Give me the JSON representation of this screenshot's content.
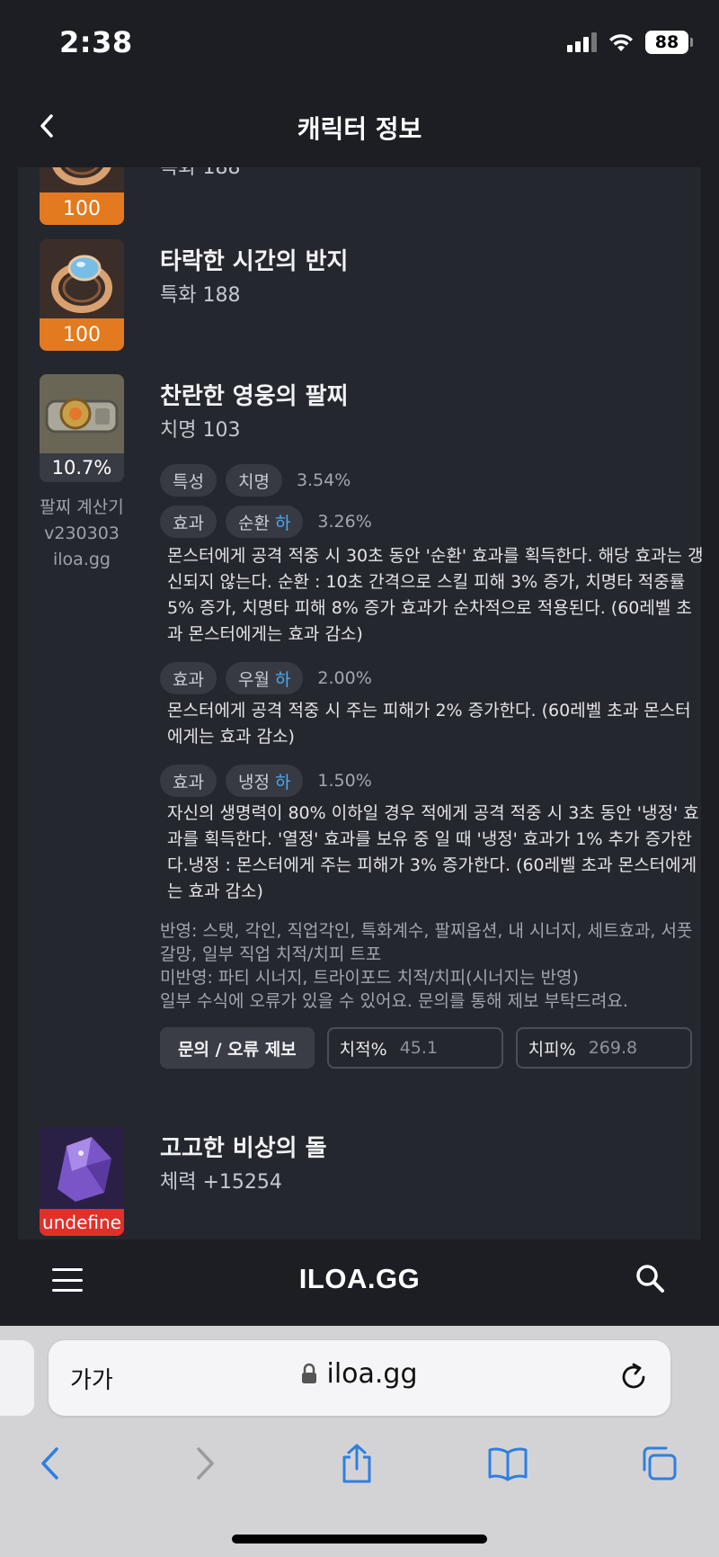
{
  "status_bar": {
    "time": "2:38",
    "battery": "88"
  },
  "header": {
    "title": "캐릭터 정보"
  },
  "items": [
    {
      "name": "",
      "stat": "특화 188",
      "quality": "100"
    },
    {
      "name": "타락한 시간의 반지",
      "stat": "특화 188",
      "quality": "100"
    },
    {
      "name": "찬란한 영웅의 팔찌",
      "stat": "치명 103",
      "percent": "10.7%"
    }
  ],
  "calculator": {
    "line1": "팔찌 계산기",
    "line2": "v230303",
    "line3": "iloa.gg"
  },
  "bracelet_options": [
    {
      "type": "특성",
      "name": "치명",
      "grade": "",
      "value": "3.54%",
      "desc": ""
    },
    {
      "type": "효과",
      "name": "순환",
      "grade": "하",
      "value": "3.26%",
      "desc": "몬스터에게 공격 적중 시 30초 동안 '순환' 효과를 획득한다. 해당 효과는 갱신되지 않는다. 순환 : 10초 간격으로 스킬 피해 3% 증가, 치명타 적중률 5% 증가, 치명타 피해 8% 증가 효과가 순차적으로 적용된다. (60레벨 초과 몬스터에게는 효과 감소)"
    },
    {
      "type": "효과",
      "name": "우월",
      "grade": "하",
      "value": "2.00%",
      "desc": "몬스터에게 공격 적중 시 주는 피해가 2% 증가한다. (60레벨 초과 몬스터에게는 효과 감소)"
    },
    {
      "type": "효과",
      "name": "냉정",
      "grade": "하",
      "value": "1.50%",
      "desc": "자신의 생명력이 80% 이하일 경우 적에게 공격 적중 시 3초 동안 '냉정' 효과를 획득한다. '열정' 효과를 보유 중 일 때 '냉정' 효과가 1% 추가 증가한다.냉정 : 몬스터에게 주는 피해가 3% 증가한다. (60레벨 초과 몬스터에게는 효과 감소)"
    }
  ],
  "notes": {
    "reflected": "반영: 스탯, 각인, 직업각인, 특화계수, 팔찌옵션, 내 시너지, 세트효과, 서풋 갈망, 일부 직업 치적/치피 트포",
    "not_reflected": "미반영: 파티 시너지, 트라이포드 치적/치피(시너지는 반영)",
    "disclaimer": "일부 수식에 오류가 있을 수 있어요. 문의를 통해 제보 부탁드려요."
  },
  "actions": {
    "report_label": "문의 / 오류 제보",
    "crit_label": "치적%",
    "crit_value": "45.1",
    "critdmg_label": "치피%",
    "critdmg_value": "269.8"
  },
  "stone": {
    "name": "고고한 비상의 돌",
    "stat": "체력 +15254",
    "quality": "undefine"
  },
  "bottom_nav": {
    "logo": "ILOA.GG"
  },
  "browser": {
    "aa_label": "가가",
    "url": "iloa.gg"
  },
  "colors": {
    "background": "#1c1e24",
    "panel": "#24272e",
    "quality_orange": "#e37a1f",
    "grade_blue": "#4ea8f0",
    "stone_red": "#e0302a"
  },
  "icons": [
    "back-chevron-icon",
    "ring-icon",
    "bracelet-icon",
    "stone-icon",
    "menu-icon",
    "search-icon",
    "lock-icon",
    "reload-icon",
    "back-icon",
    "forward-icon",
    "share-icon",
    "bookmarks-icon",
    "tabs-icon"
  ]
}
